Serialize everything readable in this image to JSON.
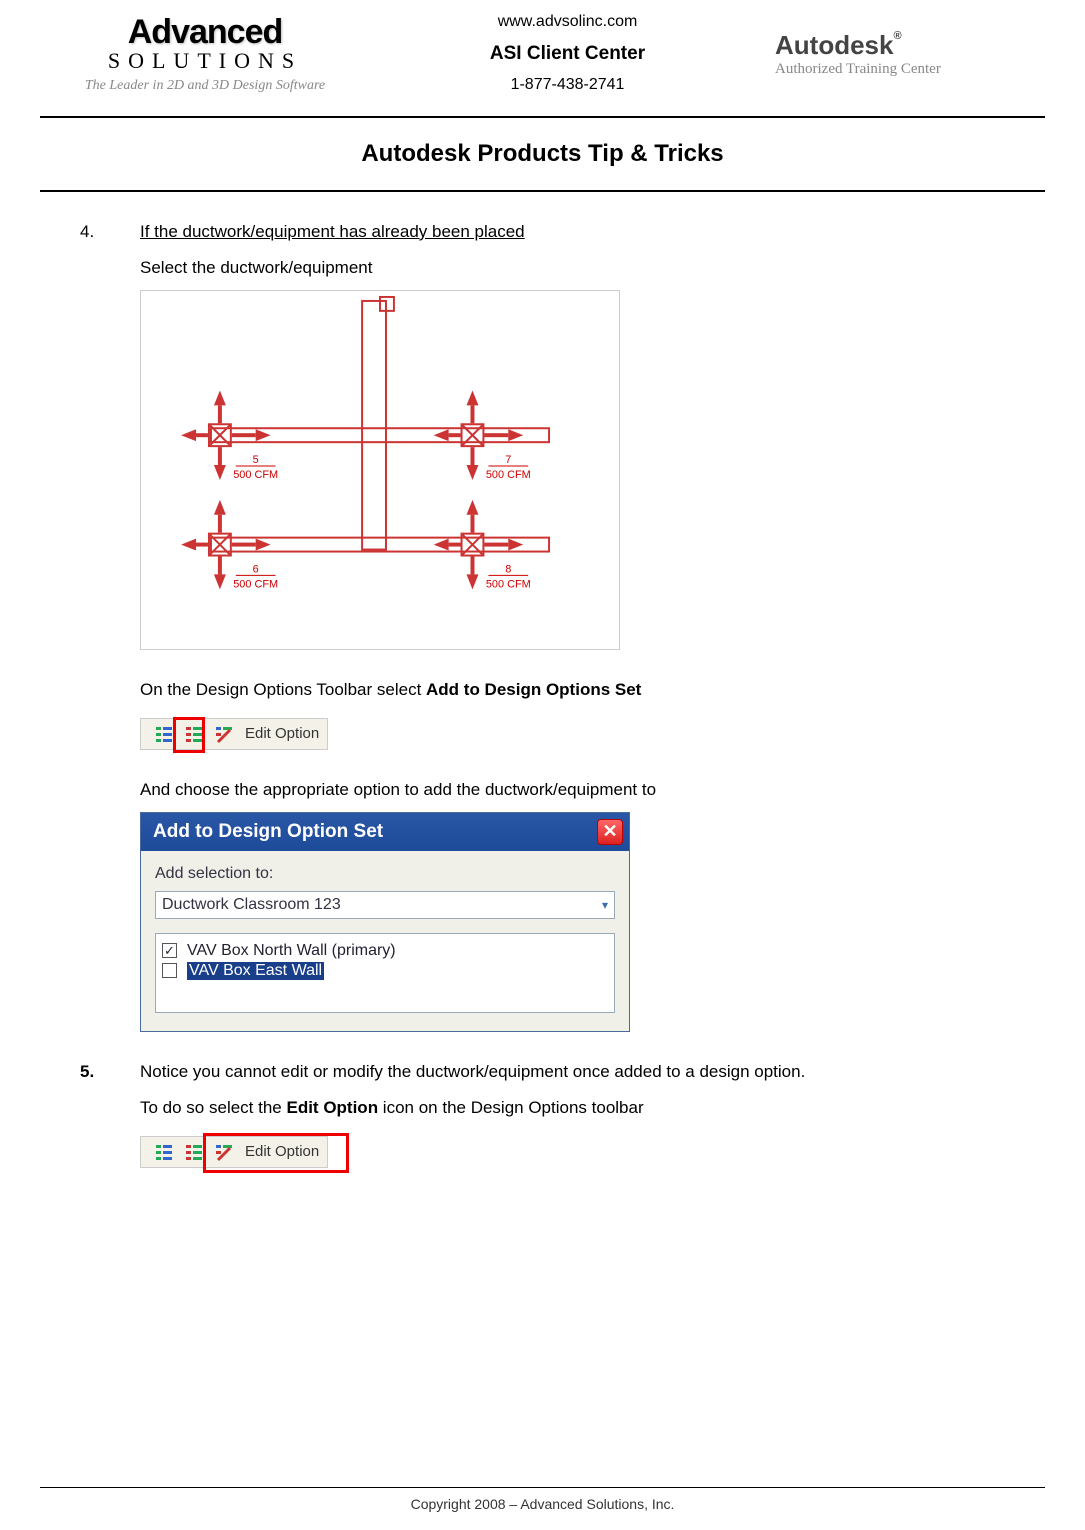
{
  "header": {
    "url": "www.advsolinc.com",
    "client_center": "ASI Client Center",
    "phone": "1-877-438-2741",
    "logo_main": "Advanced",
    "logo_sub": "SOLUTIONS",
    "logo_tag": "The Leader in 2D and 3D Design Software",
    "right_brand": "Autodesk",
    "right_sub": "Authorized Training Center"
  },
  "doc_title": "Autodesk Products Tip & Tricks",
  "steps": {
    "s4": {
      "num": "4.",
      "title": "If the ductwork/equipment has already been placed",
      "p1": "Select the ductwork/equipment",
      "p2a": "On the Design Options Toolbar select ",
      "p2b": "Add to Design Options Set",
      "p3": "And choose the appropriate option to add the ductwork/equipment to"
    },
    "s5": {
      "num": "5.",
      "p1": "Notice you cannot edit or modify the ductwork/equipment once added to a design option.",
      "p2a": "To do so select the ",
      "p2b": "Edit Option",
      "p2c": " icon on the Design Options toolbar"
    }
  },
  "duct_labels": {
    "l1": {
      "num": "5",
      "cfm": "500 CFM"
    },
    "l2": {
      "num": "7",
      "cfm": "500 CFM"
    },
    "l3": {
      "num": "6",
      "cfm": "500 CFM"
    },
    "l4": {
      "num": "8",
      "cfm": "500 CFM"
    }
  },
  "toolbar1": {
    "label": "Edit Option"
  },
  "toolbar2": {
    "label": "Edit Option"
  },
  "dialog": {
    "title": "Add to Design Option Set",
    "prompt": "Add selection to:",
    "select_value": "Ductwork Classroom 123",
    "options": [
      {
        "checked": true,
        "label": "VAV Box North Wall (primary)",
        "selected": false
      },
      {
        "checked": false,
        "label": "VAV Box East Wall",
        "selected": true
      }
    ]
  },
  "footer": "Copyright 2008 – Advanced Solutions, Inc."
}
